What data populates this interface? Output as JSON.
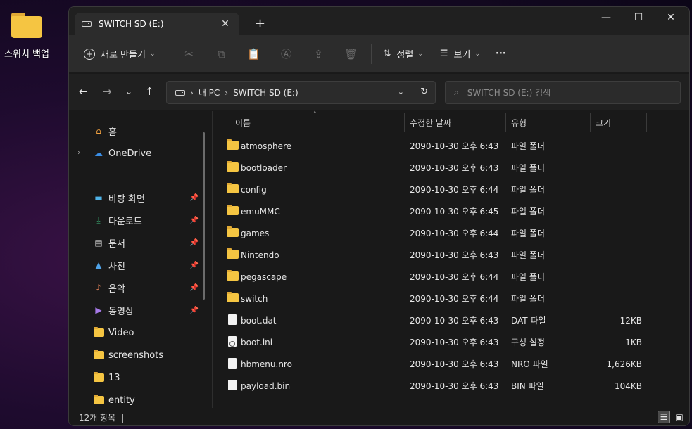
{
  "desktop": {
    "icon_label": "스위치 백업"
  },
  "window": {
    "tab_title": "SWITCH SD (E:)",
    "tab_close": "✕",
    "new_tab": "+",
    "minimize": "—",
    "maximize": "☐",
    "close": "✕"
  },
  "toolbar": {
    "new_label": "새로 만들기",
    "sort_label": "정렬",
    "view_label": "보기",
    "more_label": "···",
    "icons": [
      "cut-icon",
      "copy-icon",
      "paste-icon",
      "rename-icon",
      "share-icon",
      "delete-icon"
    ]
  },
  "address": {
    "crumbs": [
      "내 PC",
      "SWITCH SD (E:)"
    ],
    "search_placeholder": "SWITCH SD (E:) 검색"
  },
  "sidebar": {
    "home": "홈",
    "onedrive": "OneDrive",
    "pinned": [
      {
        "label": "바탕 화면",
        "icon": "desktop-icon"
      },
      {
        "label": "다운로드",
        "icon": "download-icon"
      },
      {
        "label": "문서",
        "icon": "document-icon"
      },
      {
        "label": "사진",
        "icon": "picture-icon"
      },
      {
        "label": "음악",
        "icon": "music-icon"
      },
      {
        "label": "동영상",
        "icon": "video-icon"
      }
    ],
    "folders": [
      "Video",
      "screenshots",
      "13",
      "entity"
    ]
  },
  "columns": {
    "name": "이름",
    "date": "수정한 날짜",
    "type": "유형",
    "size": "크기"
  },
  "files": [
    {
      "name": "atmosphere",
      "date": "2090-10-30 오후 6:43",
      "type": "파일 폴더",
      "size": "",
      "kind": "folder"
    },
    {
      "name": "bootloader",
      "date": "2090-10-30 오후 6:43",
      "type": "파일 폴더",
      "size": "",
      "kind": "folder"
    },
    {
      "name": "config",
      "date": "2090-10-30 오후 6:44",
      "type": "파일 폴더",
      "size": "",
      "kind": "folder"
    },
    {
      "name": "emuMMC",
      "date": "2090-10-30 오후 6:45",
      "type": "파일 폴더",
      "size": "",
      "kind": "folder"
    },
    {
      "name": "games",
      "date": "2090-10-30 오후 6:44",
      "type": "파일 폴더",
      "size": "",
      "kind": "folder"
    },
    {
      "name": "Nintendo",
      "date": "2090-10-30 오후 6:43",
      "type": "파일 폴더",
      "size": "",
      "kind": "folder"
    },
    {
      "name": "pegascape",
      "date": "2090-10-30 오후 6:44",
      "type": "파일 폴더",
      "size": "",
      "kind": "folder"
    },
    {
      "name": "switch",
      "date": "2090-10-30 오후 6:44",
      "type": "파일 폴더",
      "size": "",
      "kind": "folder"
    },
    {
      "name": "boot.dat",
      "date": "2090-10-30 오후 6:43",
      "type": "DAT 파일",
      "size": "12KB",
      "kind": "file"
    },
    {
      "name": "boot.ini",
      "date": "2090-10-30 오후 6:43",
      "type": "구성 설정",
      "size": "1KB",
      "kind": "ini"
    },
    {
      "name": "hbmenu.nro",
      "date": "2090-10-30 오후 6:43",
      "type": "NRO 파일",
      "size": "1,626KB",
      "kind": "file"
    },
    {
      "name": "payload.bin",
      "date": "2090-10-30 오후 6:43",
      "type": "BIN 파일",
      "size": "104KB",
      "kind": "file"
    }
  ],
  "status": {
    "count": "12개 항목",
    "cursor": "|"
  }
}
